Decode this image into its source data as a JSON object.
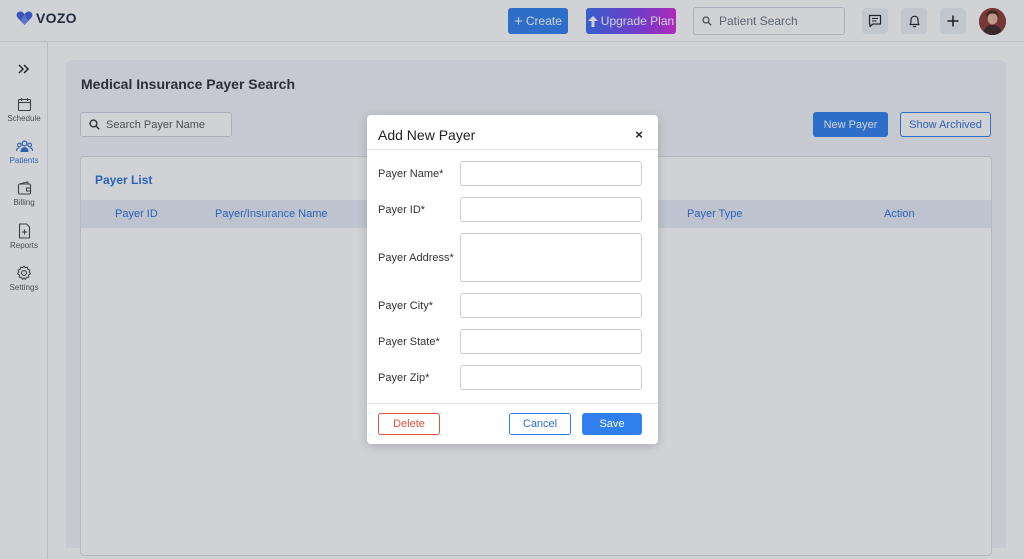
{
  "brand": {
    "name": "VOZO",
    "accent": "#2f80ed"
  },
  "topbar": {
    "create_label": "Create",
    "upgrade_label": "Upgrade Plan",
    "search_placeholder": "Patient Search"
  },
  "sidebar": {
    "items": [
      {
        "label": "Schedule",
        "icon": "calendar-icon"
      },
      {
        "label": "Patients",
        "icon": "patients-icon"
      },
      {
        "label": "Billing",
        "icon": "wallet-icon"
      },
      {
        "label": "Reports",
        "icon": "report-icon"
      },
      {
        "label": "Settings",
        "icon": "gear-icon"
      }
    ]
  },
  "page": {
    "title": "Medical Insurance Payer Search",
    "search_placeholder": "Search Payer Name",
    "new_payer_label": "New Payer",
    "show_archived_label": "Show Archived",
    "list_title": "Payer List",
    "columns": [
      "Payer ID",
      "Payer/Insurance Name",
      "Payer Type",
      "Action"
    ]
  },
  "modal": {
    "title": "Add New Payer",
    "close_symbol": "×",
    "fields": [
      {
        "label": "Payer Name*",
        "value": ""
      },
      {
        "label": "Payer ID*",
        "value": ""
      },
      {
        "label": "Payer Address*",
        "value": ""
      },
      {
        "label": "Payer City*",
        "value": ""
      },
      {
        "label": "Payer State*",
        "value": ""
      },
      {
        "label": "Payer Zip*",
        "value": ""
      }
    ],
    "delete_label": "Delete",
    "cancel_label": "Cancel",
    "save_label": "Save"
  }
}
